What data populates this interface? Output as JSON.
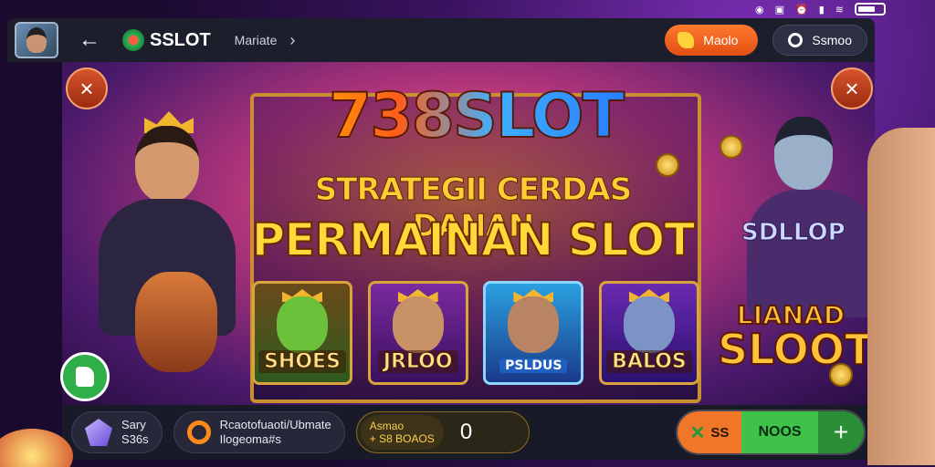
{
  "status_bar": {
    "icons": [
      "eye-icon",
      "sim-icon",
      "alarm-icon",
      "signal-icon",
      "wifi-icon",
      "battery-icon"
    ]
  },
  "topbar": {
    "logo_text": "SSLOT",
    "breadcrumb": "Mariate",
    "primary_button": "Maolo",
    "secondary_button": "Ssmoo"
  },
  "banner": {
    "title": "738SLOT",
    "subtitle_line1": "STRATEGII CERDAS DANAN",
    "subtitle_line2": "PERMAINAN SLOT",
    "side_label": "SDLLOP",
    "corner_logo_line1": "LIANAD",
    "corner_logo_line2": "SLOOT",
    "cards": [
      {
        "label": "SHOES"
      },
      {
        "label": "JRLOO"
      },
      {
        "label": "PSLDUS"
      },
      {
        "label": "BALOS"
      }
    ]
  },
  "bottombar": {
    "wallet_line1": "Sary",
    "wallet_line2": "S36s",
    "promo_line1": "Rcaotofuaoti/Ubmate",
    "promo_line2": "Ilogeoma#s",
    "amount_tag_line1": "Asmao",
    "amount_tag_line2": "+ S8 BOAOS",
    "amount_value": "0",
    "action_left_label": "SS",
    "action_mid_label": "NOOS",
    "action_plus": "+"
  },
  "colors": {
    "accent_orange": "#f0762a",
    "accent_green": "#3ec24a",
    "bar_dark": "#1d1e2c",
    "gold": "#ffc23a"
  }
}
